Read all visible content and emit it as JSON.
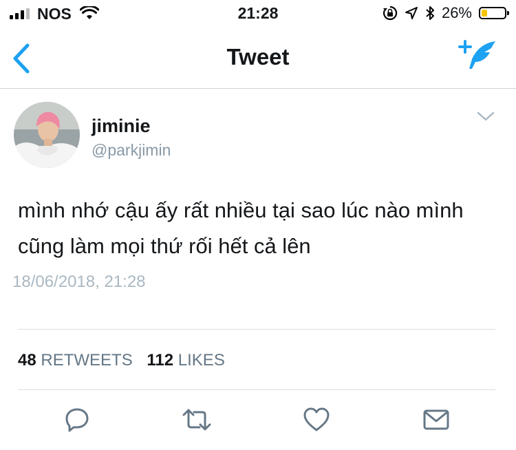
{
  "status_bar": {
    "carrier": "NOS",
    "time": "21:28",
    "battery_percent": "26%",
    "battery_level": 0.26,
    "signal_bars": 3,
    "icons": [
      "wifi-icon",
      "rotation-lock-icon",
      "location-arrow-icon",
      "bluetooth-icon",
      "battery-icon"
    ]
  },
  "nav": {
    "title": "Tweet",
    "back_icon": "chevron-left-icon",
    "compose_icon": "compose-tweet-icon",
    "accent_color": "#1da1f2"
  },
  "tweet": {
    "display_name": "jiminie",
    "handle": "@parkjimin",
    "text": "mình nhớ cậu ấy rất nhiều tại sao lúc nào mình cũng làm mọi thứ rối hết cả lên",
    "timestamp": "18/06/2018, 21:28",
    "retweets_count": "48",
    "retweets_label": "RETWEETS",
    "likes_count": "112",
    "likes_label": "LIKES"
  },
  "actions": [
    {
      "icon": "reply-icon"
    },
    {
      "icon": "retweet-icon"
    },
    {
      "icon": "like-icon"
    },
    {
      "icon": "direct-message-icon"
    }
  ],
  "colors": {
    "secondary_text": "#8899a6",
    "timestamp": "#aab8c2",
    "battery_fill": "#f5c400",
    "action_icon": "#657786"
  }
}
